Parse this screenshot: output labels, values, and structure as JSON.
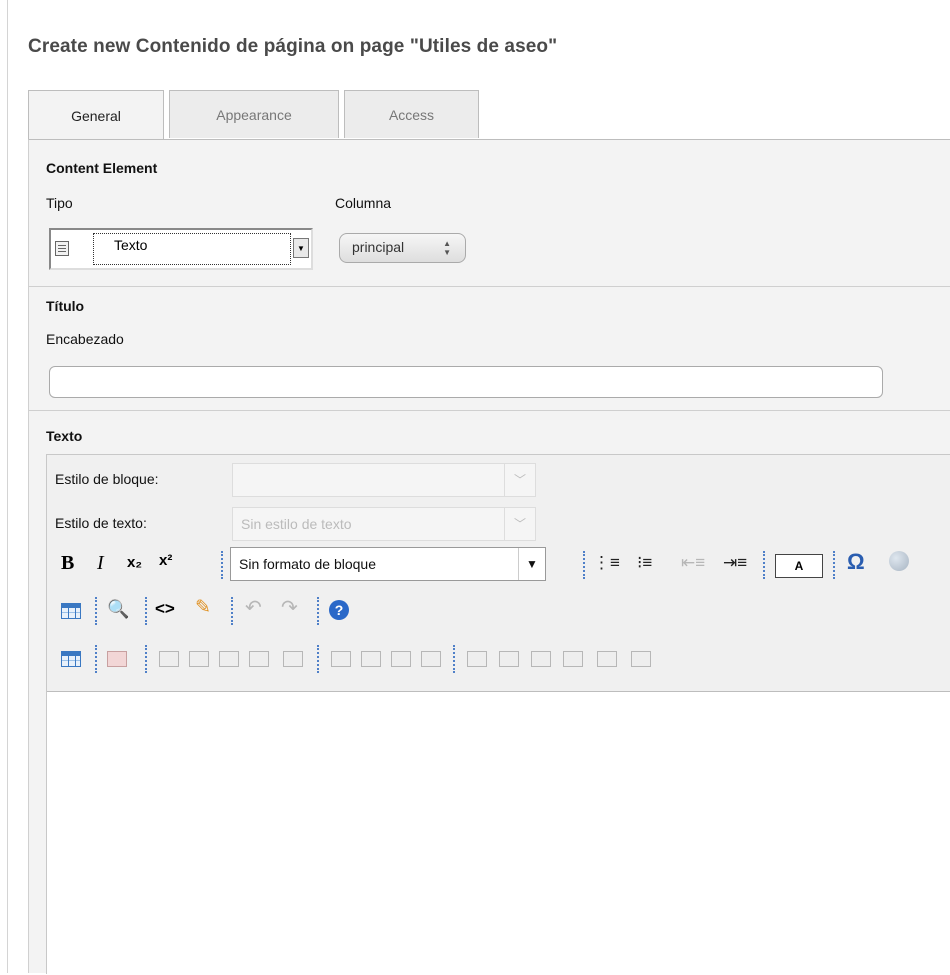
{
  "page": {
    "title": "Create new Contenido de página on page \"Utiles de aseo\""
  },
  "tabs": [
    {
      "label": "General",
      "active": true
    },
    {
      "label": "Appearance",
      "active": false
    },
    {
      "label": "Access",
      "active": false
    }
  ],
  "content_element": {
    "title": "Content Element",
    "tipo_label": "Tipo",
    "tipo_value": "Texto",
    "columna_label": "Columna",
    "columna_value": "principal"
  },
  "titulo": {
    "title": "Título",
    "encabezado_label": "Encabezado",
    "encabezado_value": ""
  },
  "texto": {
    "title": "Texto",
    "estilo_bloque_label": "Estilo de bloque:",
    "estilo_bloque_value": "",
    "estilo_texto_label": "Estilo de texto:",
    "estilo_texto_value": "Sin estilo de texto",
    "formato_bloque_value": "Sin formato de bloque",
    "toolbar": {
      "bold": "B",
      "italic": "I",
      "subscript": "x₂",
      "superscript": "x²",
      "text_color": "A",
      "special_char": "Ω",
      "source": "<>"
    },
    "body": ""
  },
  "colors": {
    "accent": "#3a78c2",
    "panel_bg": "#f3f3f3",
    "title_text": "#4a4a4a"
  }
}
